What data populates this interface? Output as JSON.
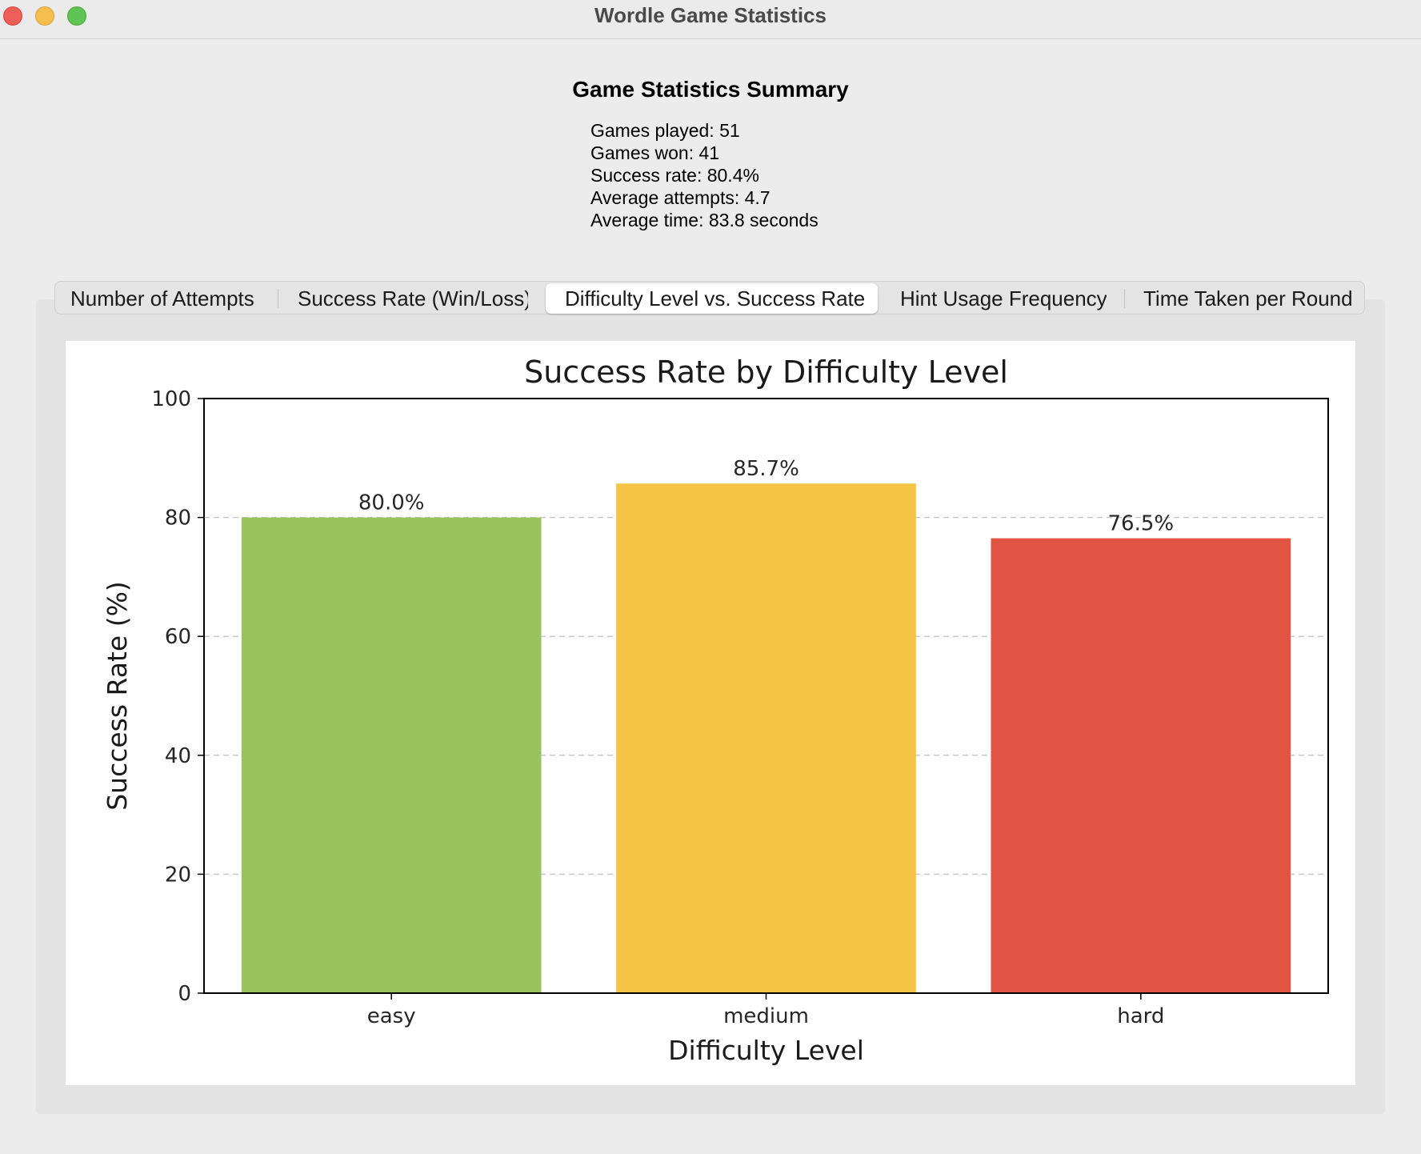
{
  "window": {
    "title": "Wordle Game Statistics"
  },
  "summary": {
    "title": "Game Statistics Summary",
    "lines": [
      "Games played: 51",
      "Games won: 41",
      "Success rate: 80.4%",
      "Average attempts: 4.7",
      "Average time: 83.8 seconds"
    ]
  },
  "tabs": [
    {
      "label": "Number of Attempts",
      "active": false
    },
    {
      "label": "Success Rate (Win/Loss)",
      "active": false
    },
    {
      "label": "Difficulty Level vs. Success Rate",
      "active": true
    },
    {
      "label": "Hint Usage Frequency",
      "active": false
    },
    {
      "label": "Time Taken per Round",
      "active": false
    }
  ],
  "chart_data": {
    "type": "bar",
    "title": "Success Rate by Difficulty Level",
    "xlabel": "Difficulty Level",
    "ylabel": "Success Rate (%)",
    "categories": [
      "easy",
      "medium",
      "hard"
    ],
    "values": [
      80.0,
      85.7,
      76.5
    ],
    "data_labels": [
      "80.0%",
      "85.7%",
      "76.5%"
    ],
    "colors": [
      "#9ac25f",
      "#f6c445",
      "#e15342"
    ],
    "ylim": [
      0,
      100
    ],
    "yticks": [
      0,
      20,
      40,
      60,
      80,
      100
    ],
    "grid": "y-dashed",
    "legend": "none"
  }
}
